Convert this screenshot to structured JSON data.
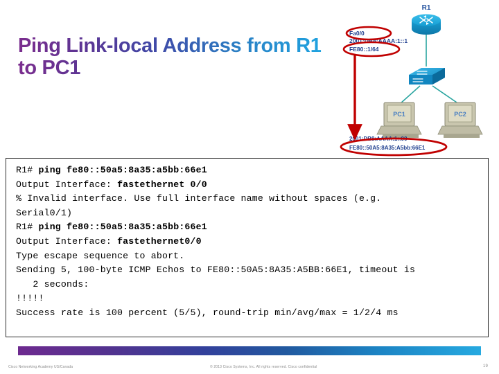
{
  "slide": {
    "title": "Ping Link-local Address from R1 to PC1",
    "page_number": "19"
  },
  "topology": {
    "router_label": "R1",
    "router_iface_label": "Fa0/0",
    "router_global_addr": "2001:DB8:AAAA:1::1",
    "router_linklocal_addr": "FE80::1/64",
    "pc1_label": "PC1",
    "pc2_label": "PC2",
    "pc1_global_addr": "2001:DB8:AAAA:1::99",
    "pc1_linklocal_addr": "FE80::50A5:8A35:A5bb:66E1",
    "highlight_color": "#c00000",
    "device_color": "#1ba1d6",
    "link_color": "#2aa5a0"
  },
  "cli": {
    "lines": [
      {
        "plain": "R1# ",
        "bold": "ping fe80::50a5:8a35:a5bb:66e1",
        "tail": ""
      },
      {
        "plain": "Output Interface: ",
        "bold": "fastethernet 0/0",
        "tail": ""
      },
      {
        "plain": "% Invalid interface. Use full interface name without spaces (e.g.",
        "bold": "",
        "tail": ""
      },
      {
        "plain": "Serial0/1)",
        "bold": "",
        "tail": ""
      },
      {
        "plain": "R1# ",
        "bold": "ping fe80::50a5:8a35:a5bb:66e1",
        "tail": ""
      },
      {
        "plain": "Output Interface: ",
        "bold": "fastethernet0/0",
        "tail": ""
      },
      {
        "plain": "Type escape sequence to abort.",
        "bold": "",
        "tail": ""
      },
      {
        "plain": "Sending 5, 100-byte ICMP Echos to FE80::50A5:8A35:A5BB:66E1, timeout is",
        "bold": "",
        "tail": ""
      },
      {
        "plain": "   2 seconds:",
        "bold": "",
        "tail": ""
      },
      {
        "plain": "!!!!!",
        "bold": "",
        "tail": ""
      },
      {
        "plain": "Success rate is 100 percent (5/5), round-trip min/avg/max = 1/2/4 ms",
        "bold": "",
        "tail": ""
      }
    ]
  },
  "footer": {
    "left": "Cisco Networking Academy  US/Canada",
    "center": "© 2013 Cisco Systems, Inc. All rights reserved.  Cisco confidential",
    "page": "19"
  },
  "theme": {
    "gradient_start": "#6d2a8f",
    "gradient_end": "#26a9e0"
  }
}
